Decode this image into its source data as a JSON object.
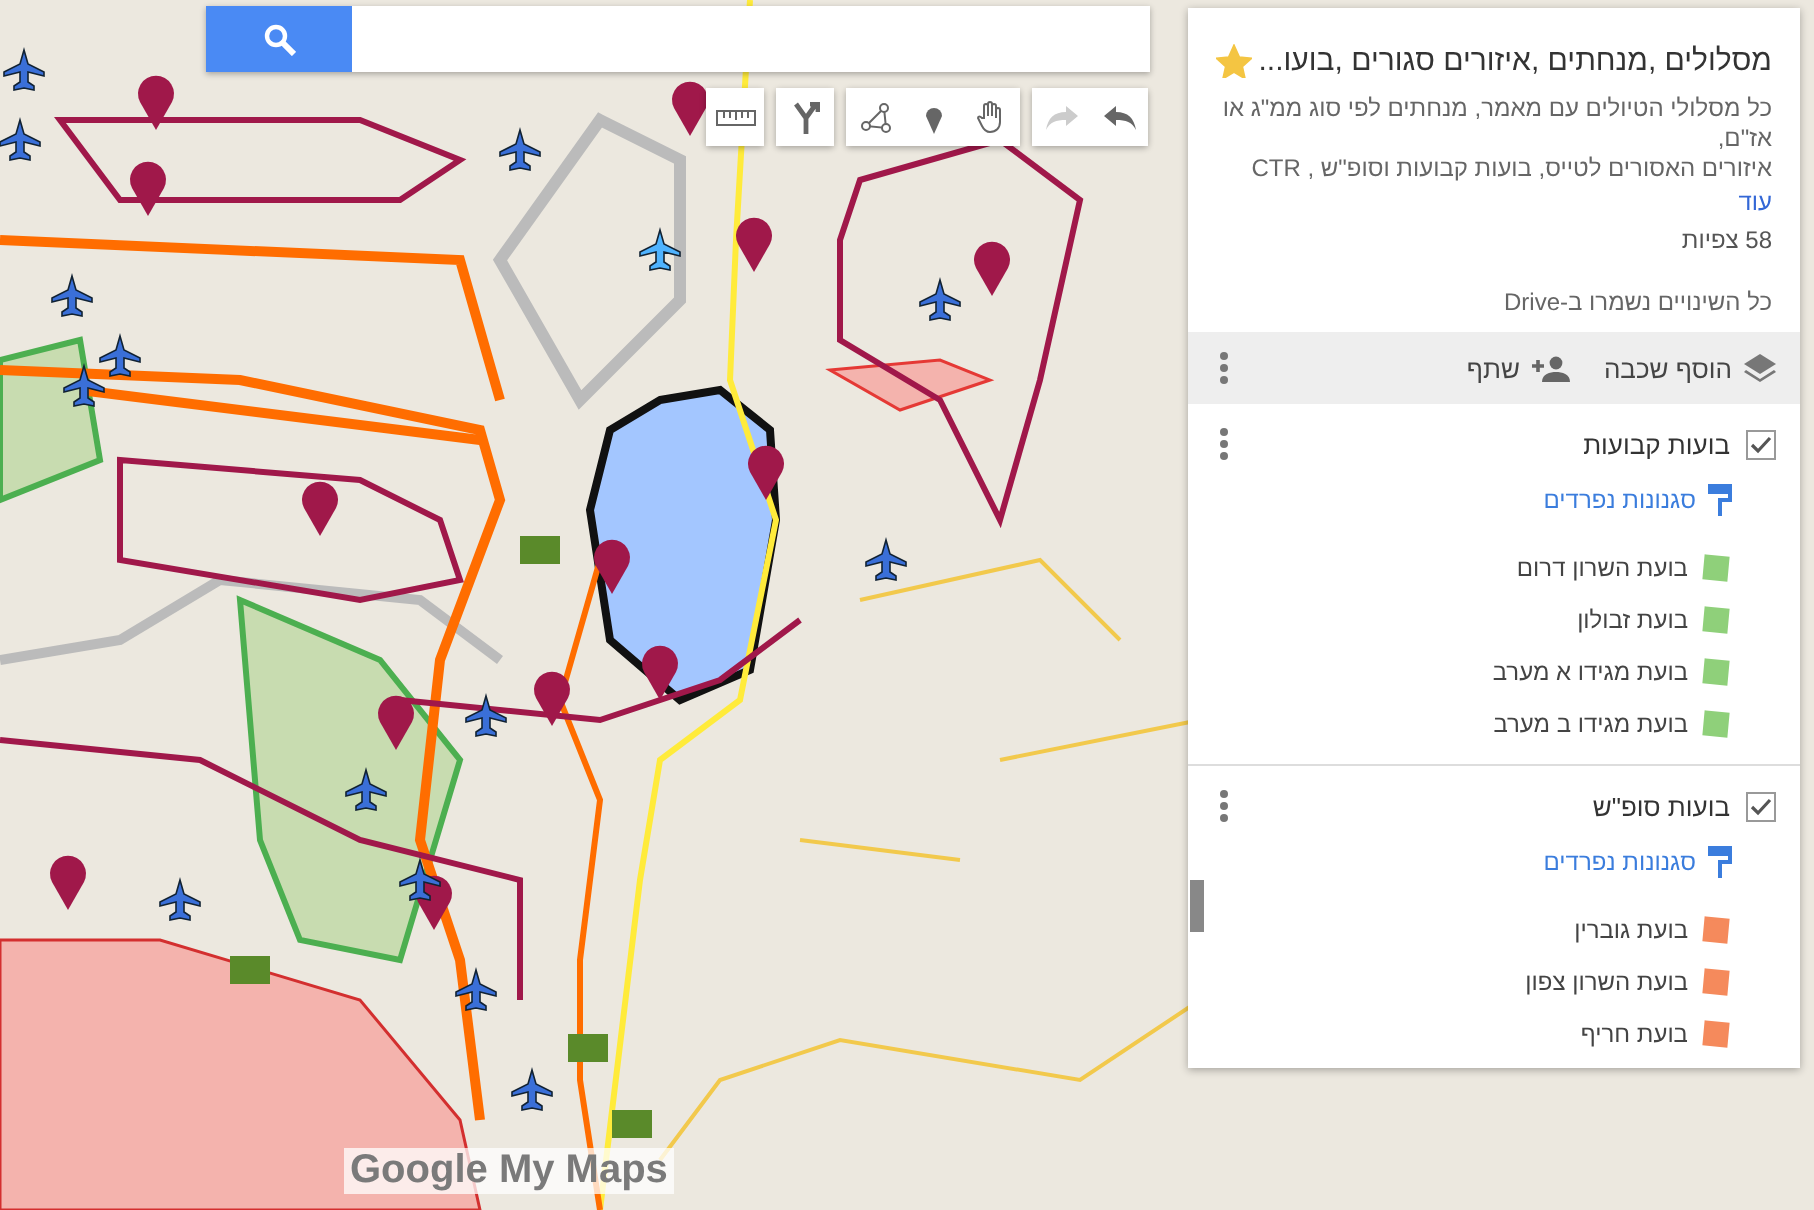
{
  "map": {
    "logo": "Google My Maps"
  },
  "toolbar": [
    {
      "kind": "ruler",
      "disabled": false
    },
    {
      "kind": "directions",
      "disabled": false
    },
    {
      "kind": "line",
      "disabled": false
    },
    {
      "kind": "marker",
      "disabled": false
    },
    {
      "kind": "hand",
      "disabled": false
    },
    {
      "kind": "redo",
      "disabled": true
    },
    {
      "kind": "undo",
      "disabled": false
    }
  ],
  "panel": {
    "title": "מסלולים ,מנחתים ,איזורים סגורים ,בועו...",
    "starred": true,
    "description": [
      "כל מסלולי הטיולים עם מאמר, מנחתים לפי סוג ממ\"ג או אז\"ם,",
      "איזורים האסורים לטייס, בועות קבועות וסופ\"ש , CTR"
    ],
    "more_link": "עוד",
    "views": "58 צפיות",
    "saved_status": "כל השינויים נשמרו ב-Drive",
    "actions": [
      {
        "kind": "add-layer",
        "label": "הוסף שכבה"
      },
      {
        "kind": "share",
        "label": "שתף"
      }
    ],
    "layers": [
      {
        "name": "בועות קבועות",
        "checked": true,
        "style_link": "סגנונות נפרדים",
        "items": [
          {
            "name": "בועת השרון דרום",
            "color": "#8fd07a"
          },
          {
            "name": "בועת זבולון",
            "color": "#8fd07a"
          },
          {
            "name": "בועת מגידו א מערב",
            "color": "#8fd07a"
          },
          {
            "name": "בועת מגידו ב מערב",
            "color": "#8fd07a"
          }
        ]
      },
      {
        "name": "בועות סופ\"ש",
        "checked": true,
        "style_link": "סגנונות נפרדים",
        "items": [
          {
            "name": "בועת גוברין",
            "color": "#f58a5c"
          },
          {
            "name": "בועת השרון צפון",
            "color": "#f58a5c"
          },
          {
            "name": "בועת חריף",
            "color": "#f58a5c"
          }
        ]
      }
    ]
  }
}
